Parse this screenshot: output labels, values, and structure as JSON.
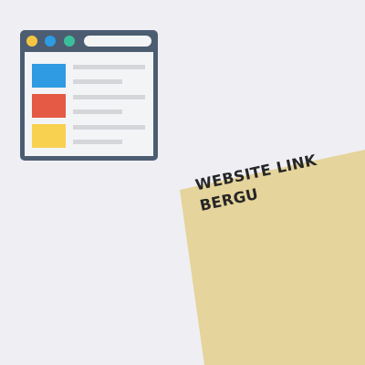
{
  "card": {
    "line1": "WEBSITE LINK",
    "line2": "BERGU"
  },
  "icon": {
    "name": "browser-window-icon",
    "dot_colors": [
      "#f4c542",
      "#2e9be2",
      "#3bbf9a"
    ],
    "tile_colors": [
      "#2e9be2",
      "#e45a45",
      "#f9d150"
    ]
  },
  "colors": {
    "background": "#efeef3",
    "card": "#e5d49b",
    "card_shadow": "#c9c5cc",
    "window_frame": "#4c5d72",
    "window_body": "#f3f4f6",
    "line": "#d4d6da",
    "text": "#262626"
  }
}
